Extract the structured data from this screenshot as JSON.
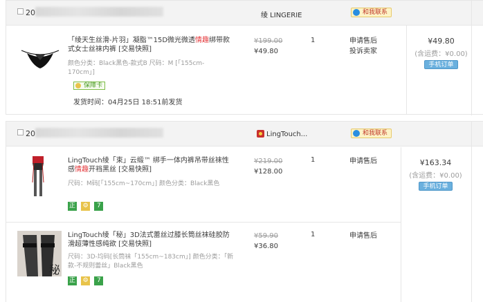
{
  "orders": [
    {
      "order_no": "20",
      "shop": "绫 LINGERIE",
      "contact_label": "和我联系",
      "total": "¥49.80",
      "shipping": "(含运费：¥0.00)",
      "action_label": "手机订单",
      "items": [
        {
          "title_prefix": "「绫天生丝滑-片羽」凝脂™15D微光微透",
          "title_highlight": "情趣",
          "title_suffix": "绑带款式女士丝袜内裤 [交易快照]",
          "sku": "颜色分类：Black黑色-款式B  尺码：M [「155cm-170cm」]",
          "old_price": "¥199.00",
          "price": "¥49.80",
          "qty": "1",
          "service_1": "申请售后",
          "service_2": "投诉卖家",
          "guarantee_label": "保障卡",
          "ship_time": "发货时间：04月25日 18:51前发货"
        }
      ]
    },
    {
      "order_no": "20",
      "shop": "LingTouch...",
      "contact_label": "和我联系",
      "total": "¥163.34",
      "shipping": "(含运费：¥0.00)",
      "action_label": "手机订单",
      "items": [
        {
          "title_prefix": "LingTouch绫「束」云缎™ 绑手一体内裤吊带丝袜性感",
          "title_highlight": "情趣",
          "title_suffix": "开裆黑丝 [交易快照]",
          "sku": "尺码：M码[「155cm~170cm」] 颜色分类：Black黑色",
          "old_price": "¥219.00",
          "price": "¥128.00",
          "qty": "1",
          "service_1": "申请售后",
          "badges": [
            "正",
            "",
            "7"
          ]
        },
        {
          "title_prefix": "LingTouch绫「秘」3D法式蕾丝过膝长筒丝袜硅胶防滑超薄性感",
          "title_highlight": "",
          "title_suffix": "纯欲 [交易快照]",
          "sku": "尺码：3D-均码[长筒袜「155cm~183cm」] 颜色分类：「新款-不规则蕾丝」Black黑色",
          "old_price": "¥59.90",
          "price": "¥36.80",
          "qty": "1",
          "service_1": "申请售后",
          "badges": [
            "正",
            "",
            "7"
          ],
          "thumb_glyph": "秘"
        }
      ]
    }
  ]
}
